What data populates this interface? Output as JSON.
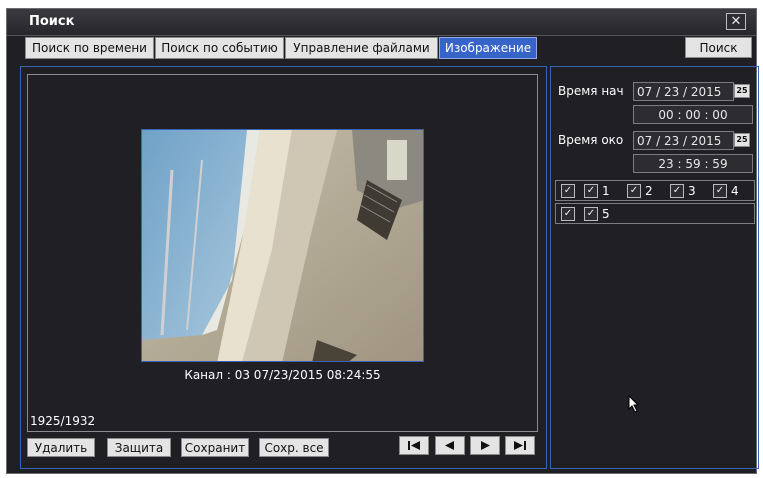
{
  "window": {
    "title": "Поиск",
    "close_glyph": "✕"
  },
  "tabs": [
    {
      "label": "Поиск по времени",
      "active": false
    },
    {
      "label": "Поиск по событию",
      "active": false
    },
    {
      "label": "Управление файлами",
      "active": false
    },
    {
      "label": "Изображение",
      "active": true
    }
  ],
  "search_button": "Поиск",
  "viewer": {
    "caption": "Канал : 03  07/23/2015 08:24:55",
    "counter": "1925/1932"
  },
  "actions": {
    "delete": "Удалить",
    "protect": "Защита",
    "save": "Сохранит",
    "save_all": "Сохр. все"
  },
  "playback_icons": [
    "first-icon",
    "prev-icon",
    "next-icon",
    "last-icon"
  ],
  "time_filter": {
    "start_label": "Время нач",
    "start_date": "07 / 23 / 2015",
    "start_time": "00  :  00  :  00",
    "end_label": "Время око",
    "end_date": "07 / 23 / 2015",
    "end_time": "23  :  59  :  59",
    "calendar_glyph": "25"
  },
  "channels": {
    "row1": [
      "1",
      "2",
      "3",
      "4"
    ],
    "row2": [
      "5"
    ],
    "all_checked": true
  },
  "colors": {
    "accent": "#3764c8",
    "window_bg": "#1f1f24",
    "panel_border": "#3a63b8"
  }
}
